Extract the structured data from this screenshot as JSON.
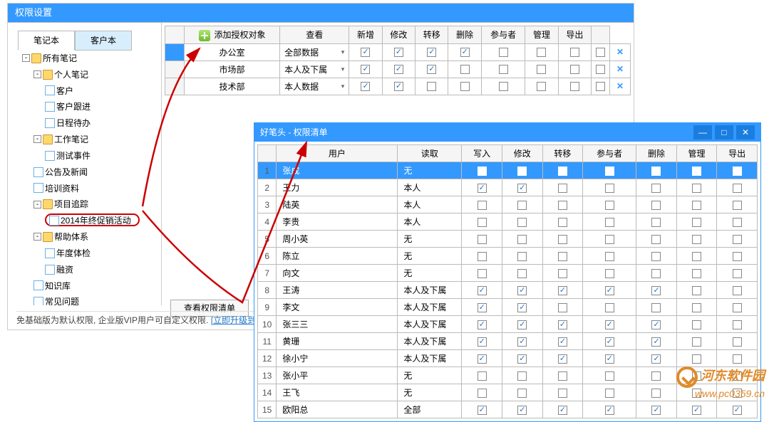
{
  "window": {
    "title": "权限设置"
  },
  "tabs": {
    "notebook": "笔记本",
    "customer": "客户本"
  },
  "tree": {
    "root": "所有笔记",
    "personal": "个人笔记",
    "customer": "客户",
    "followup": "客户跟进",
    "schedule": "日程待办",
    "work": "工作笔记",
    "testevent": "测试事件",
    "notice": "公告及新闻",
    "training": "培训资料",
    "project": "项目追踪",
    "promo": "2014年终促销活动",
    "help": "帮助体系",
    "health": "年度体检",
    "finance": "融资",
    "knowledge": "知识库",
    "faq": "常见问题"
  },
  "permHeader": {
    "add": "添加授权对象",
    "view": "查看",
    "new": "新增",
    "edit": "修改",
    "transfer": "转移",
    "delete": "删除",
    "participant": "参与者",
    "manage": "管理",
    "export": "导出"
  },
  "permRows": [
    {
      "name": "办公室",
      "scope": "全部数据",
      "checks": [
        true,
        true,
        true,
        true,
        false,
        false,
        false,
        false
      ]
    },
    {
      "name": "市场部",
      "scope": "本人及下属",
      "checks": [
        true,
        true,
        true,
        false,
        false,
        false,
        false,
        false
      ]
    },
    {
      "name": "技术部",
      "scope": "本人数据",
      "checks": [
        true,
        true,
        false,
        false,
        false,
        false,
        false,
        false
      ]
    }
  ],
  "viewPermBtn": "查看权限清单",
  "footer": {
    "text": "免基础版为默认权限, 企业版VIP用户可自定义权限.",
    "link": "[立即升级到"
  },
  "popup": {
    "title": "好笔头 - 权限清单",
    "header": {
      "user": "用户",
      "read": "读取",
      "write": "写入",
      "edit": "修改",
      "transfer": "转移",
      "participant": "参与者",
      "delete": "删除",
      "manage": "管理",
      "export": "导出"
    },
    "rows": [
      {
        "n": "1",
        "user": "张成",
        "read": "无",
        "checks": [
          false,
          false,
          false,
          false,
          false,
          false,
          false
        ]
      },
      {
        "n": "2",
        "user": "王力",
        "read": "本人",
        "checks": [
          true,
          true,
          false,
          false,
          false,
          false,
          false
        ]
      },
      {
        "n": "3",
        "user": "陆英",
        "read": "本人",
        "checks": [
          false,
          false,
          false,
          false,
          false,
          false,
          false
        ]
      },
      {
        "n": "4",
        "user": "李贵",
        "read": "本人",
        "checks": [
          false,
          false,
          false,
          false,
          false,
          false,
          false
        ]
      },
      {
        "n": "5",
        "user": "周小英",
        "read": "无",
        "checks": [
          false,
          false,
          false,
          false,
          false,
          false,
          false
        ]
      },
      {
        "n": "6",
        "user": "陈立",
        "read": "无",
        "checks": [
          false,
          false,
          false,
          false,
          false,
          false,
          false
        ]
      },
      {
        "n": "7",
        "user": "向文",
        "read": "无",
        "checks": [
          false,
          false,
          false,
          false,
          false,
          false,
          false
        ]
      },
      {
        "n": "8",
        "user": "王涛",
        "read": "本人及下属",
        "checks": [
          true,
          true,
          true,
          true,
          true,
          false,
          false
        ]
      },
      {
        "n": "9",
        "user": "李文",
        "read": "本人及下属",
        "checks": [
          true,
          true,
          false,
          false,
          false,
          false,
          false
        ]
      },
      {
        "n": "10",
        "user": "张三三",
        "read": "本人及下属",
        "checks": [
          true,
          true,
          true,
          true,
          true,
          false,
          false
        ]
      },
      {
        "n": "11",
        "user": "黄珊",
        "read": "本人及下属",
        "checks": [
          true,
          true,
          true,
          true,
          true,
          false,
          false
        ]
      },
      {
        "n": "12",
        "user": "徐小宁",
        "read": "本人及下属",
        "checks": [
          true,
          true,
          true,
          true,
          true,
          false,
          false
        ]
      },
      {
        "n": "13",
        "user": "张小平",
        "read": "无",
        "checks": [
          false,
          false,
          false,
          false,
          false,
          false,
          false
        ]
      },
      {
        "n": "14",
        "user": "王飞",
        "read": "无",
        "checks": [
          false,
          false,
          false,
          false,
          false,
          false,
          false
        ]
      },
      {
        "n": "15",
        "user": "欧阳总",
        "read": "全部",
        "checks": [
          true,
          true,
          true,
          true,
          true,
          true,
          true
        ]
      }
    ]
  },
  "watermark": {
    "brand": "河东软件园",
    "url": "www.pc0359.cn"
  }
}
